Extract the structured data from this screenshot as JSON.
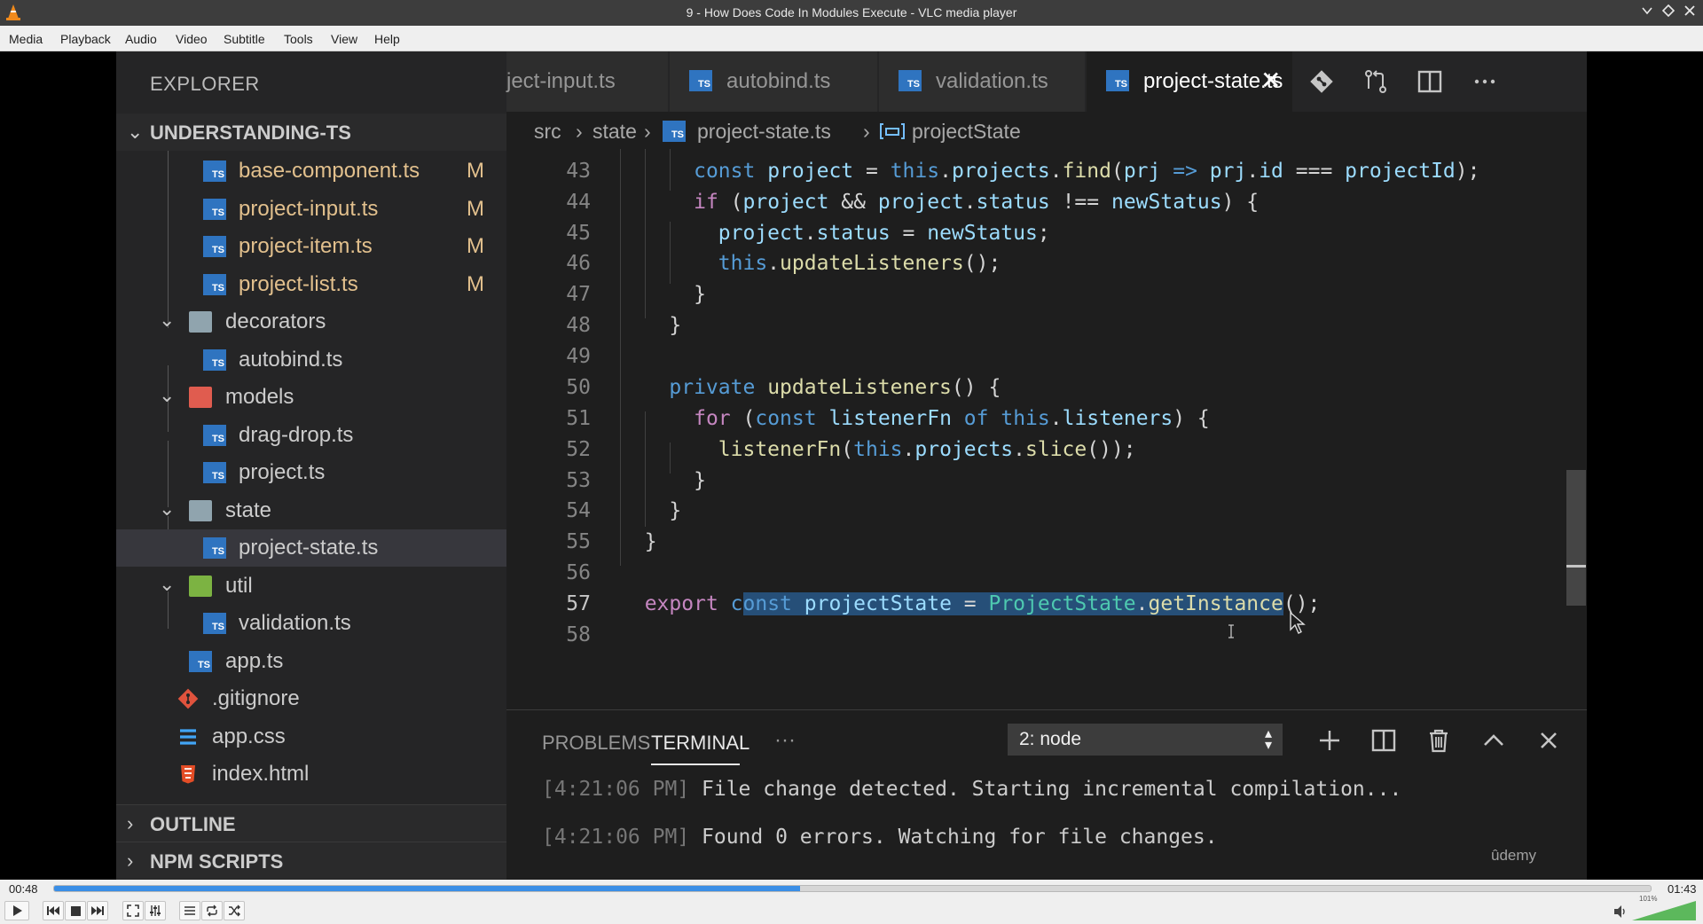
{
  "window": {
    "title": "9 - How Does Code In Modules Execute - VLC media player"
  },
  "menu": [
    "Media",
    "Playback",
    "Audio",
    "Video",
    "Subtitle",
    "Tools",
    "View",
    "Help"
  ],
  "explorer": {
    "title": "EXPLORER",
    "root": "UNDERSTANDING-TS",
    "items": [
      {
        "name": "base-component.ts",
        "badge": "M"
      },
      {
        "name": "project-input.ts",
        "badge": "M"
      },
      {
        "name": "project-item.ts",
        "badge": "M"
      },
      {
        "name": "project-list.ts",
        "badge": "M"
      },
      {
        "name": "decorators"
      },
      {
        "name": "autobind.ts"
      },
      {
        "name": "models"
      },
      {
        "name": "drag-drop.ts"
      },
      {
        "name": "project.ts"
      },
      {
        "name": "state"
      },
      {
        "name": "project-state.ts"
      },
      {
        "name": "util"
      },
      {
        "name": "validation.ts"
      },
      {
        "name": "app.ts"
      },
      {
        "name": ".gitignore"
      },
      {
        "name": "app.css"
      },
      {
        "name": "index.html"
      }
    ],
    "outline": "OUTLINE",
    "npm_scripts": "NPM SCRIPTS"
  },
  "tabs": [
    {
      "label": "ject-input.ts"
    },
    {
      "label": "autobind.ts"
    },
    {
      "label": "validation.ts"
    },
    {
      "label": "project-state.ts",
      "close": "✕"
    }
  ],
  "breadcrumb": {
    "src": "src",
    "state": "state",
    "file": "project-state.ts",
    "symbol": "projectState",
    "sep": "›"
  },
  "editor": {
    "lines": [
      "43",
      "44",
      "45",
      "46",
      "47",
      "48",
      "49",
      "50",
      "51",
      "52",
      "53",
      "54",
      "55",
      "56",
      "57",
      "58"
    ],
    "current_line": "57"
  },
  "panel": {
    "problems": "PROBLEMS",
    "terminal": "TERMINAL",
    "more": "···",
    "terminal_select": "2: node",
    "lines": [
      {
        "time": "[4:21:06 PM]",
        "text": " File change detected. Starting incremental compilation..."
      },
      {
        "time": "[4:21:06 PM]",
        "text": " Found 0 errors. Watching for file changes."
      }
    ]
  },
  "watermark": "ûdemy",
  "player": {
    "elapsed": "00:48",
    "total": "01:43",
    "progress": 0.4672,
    "volume_label": "101%",
    "volume": 1.01
  },
  "colors": {
    "accent": "#3a8ee6",
    "ts_icon": "#2f74c0",
    "modified": "#e2c08d",
    "selection": "#264f78"
  }
}
